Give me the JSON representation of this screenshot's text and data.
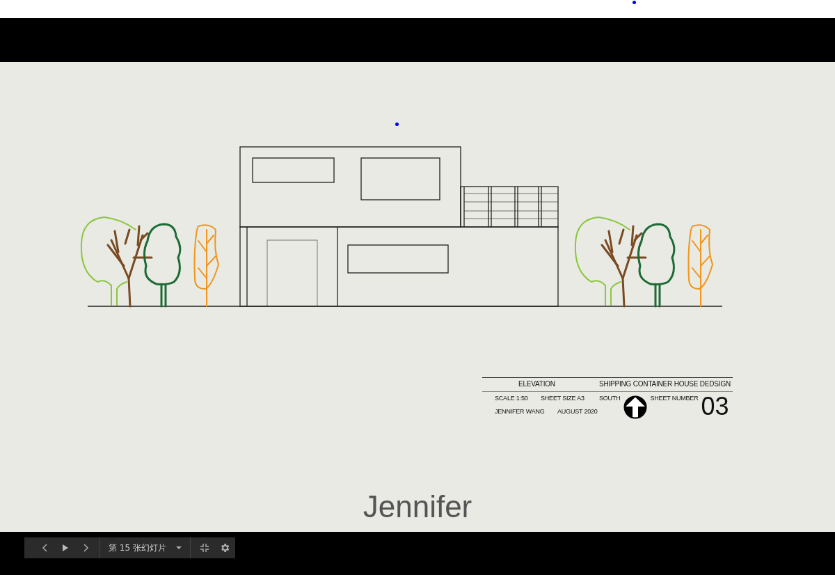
{
  "slide": {
    "title_block": {
      "view_label": "ELEVATION",
      "project_title": "SHIPPING CONTAINER HOUSE DEDSIGN",
      "scale": "SCALE 1:50",
      "sheet_size": "SHEET SIZE A3",
      "orientation": "SOUTH",
      "sheet_number_label": "SHEET NUMBER",
      "sheet_number": "03",
      "author": "JENNIFER WANG",
      "date": "AUGUST 2020"
    },
    "caption": "Jennifer"
  },
  "presenter_toolbar": {
    "slide_label": "第 15 张幻灯片"
  }
}
